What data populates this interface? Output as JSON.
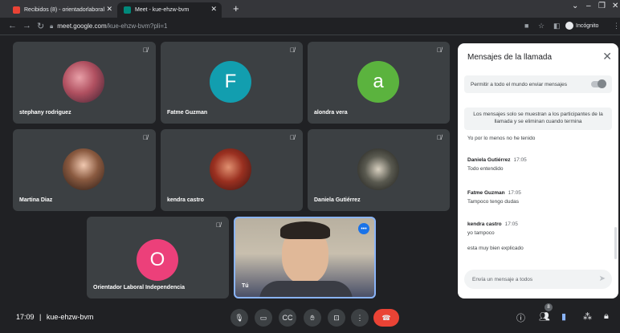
{
  "browser": {
    "tabs": [
      {
        "label": "Recibidos (8) - orientadorlaboral",
        "active": false
      },
      {
        "label": "Meet - kue-ehzw-bvm",
        "active": true
      }
    ],
    "new_tab": "+",
    "url_host": "meet.google.com",
    "url_path": "/kue-ehzw-bvm?pli=1",
    "incognito_label": "Incógnito"
  },
  "participants": [
    {
      "name": "stephany rodriguez",
      "avatar_type": "photo"
    },
    {
      "name": "Fatme Guzman",
      "avatar_type": "letter",
      "letter": "F",
      "color": "#129eaf"
    },
    {
      "name": "alondra vera",
      "avatar_type": "letter",
      "letter": "a",
      "color": "#5bb33e"
    },
    {
      "name": "Martina Diaz",
      "avatar_type": "photo"
    },
    {
      "name": "kendra castro",
      "avatar_type": "photo"
    },
    {
      "name": "Daniela Gutiérrez",
      "avatar_type": "photo"
    },
    {
      "name": "Orientador Laboral Independencia",
      "avatar_type": "letter",
      "letter": "O",
      "color": "#ec407a"
    },
    {
      "name": "Tú",
      "avatar_type": "video"
    }
  ],
  "chat": {
    "title": "Mensajes de la llamada",
    "permission_label": "Permitir a todo el mundo enviar mensajes",
    "notice": "Los mensajes solo se muestran a los participantes de la llamada y se eliminan cuando termina",
    "messages": [
      {
        "sender": "",
        "time": "",
        "text": "Yo por lo menos no he tenido"
      },
      {
        "sender": "Daniela Gutiérrez",
        "time": "17:05",
        "text": "Todo entendido"
      },
      {
        "sender": "Fatme Guzman",
        "time": "17:05",
        "text": "Tampoco tengo dudas"
      },
      {
        "sender": "kendra castro",
        "time": "17:05",
        "text": "yo tampoco"
      },
      {
        "sender": "",
        "time": "",
        "text": "esta muy bien explicado"
      }
    ],
    "input_placeholder": "Envía un mensaje a todos"
  },
  "bottom": {
    "time": "17:09",
    "separator": "|",
    "meeting_code": "kue-ehzw-bvm",
    "participant_count": "8"
  },
  "colors": {
    "background": "#202124",
    "tile": "#3c4043",
    "end_call": "#ea4335",
    "chat_accent": "#1a73e8"
  }
}
